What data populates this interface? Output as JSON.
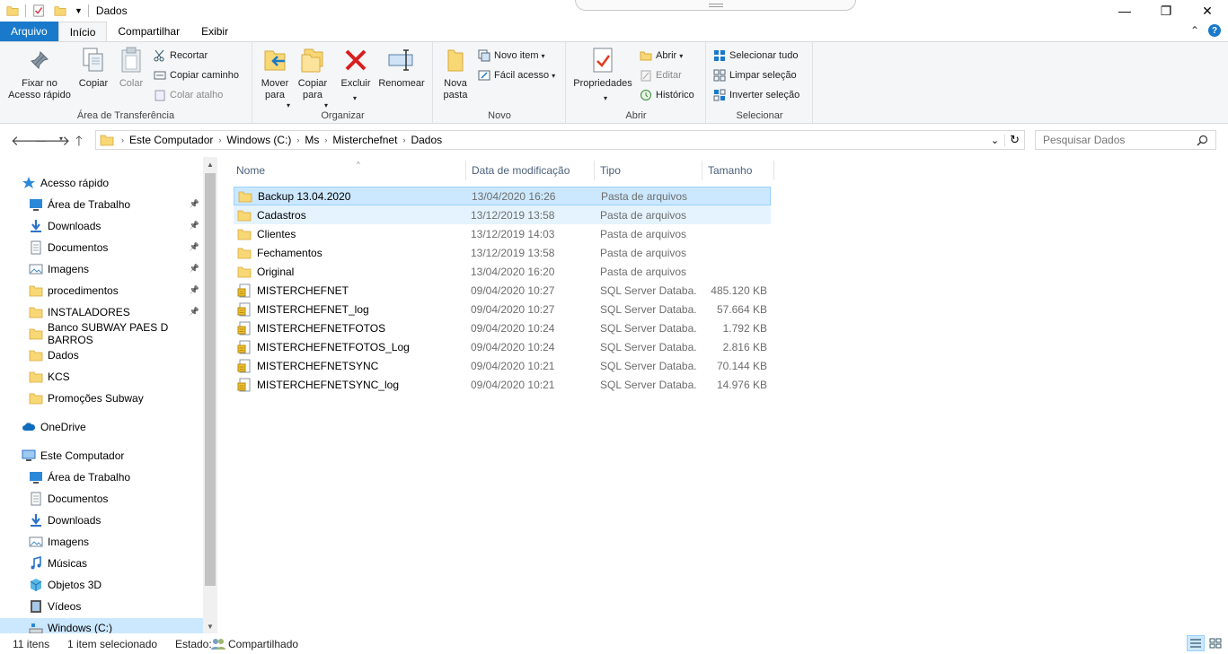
{
  "window": {
    "title": "Dados"
  },
  "ribbon_tabs": [
    "Arquivo",
    "Início",
    "Compartilhar",
    "Exibir"
  ],
  "ribbon": {
    "clipboard": {
      "label": "Área de Transferência",
      "pin": "Fixar no\nAcesso rápido",
      "copy": "Copiar",
      "paste": "Colar",
      "cut": "Recortar",
      "copy_path": "Copiar caminho",
      "paste_shortcut": "Colar atalho"
    },
    "organize": {
      "label": "Organizar",
      "move_to": "Mover\npara",
      "copy_to": "Copiar\npara",
      "delete": "Excluir",
      "rename": "Renomear"
    },
    "new": {
      "label": "Novo",
      "new_folder": "Nova\npasta",
      "new_item": "Novo item",
      "easy_access": "Fácil acesso"
    },
    "open": {
      "label": "Abrir",
      "properties": "Propriedades",
      "open": "Abrir",
      "edit": "Editar",
      "history": "Histórico"
    },
    "select": {
      "label": "Selecionar",
      "select_all": "Selecionar tudo",
      "select_none": "Limpar seleção",
      "invert": "Inverter seleção"
    }
  },
  "address": {
    "crumbs": [
      "Este Computador",
      "Windows (C:)",
      "Ms",
      "Misterchefnet",
      "Dados"
    ]
  },
  "search": {
    "placeholder": "Pesquisar Dados"
  },
  "nav": {
    "quick_access": "Acesso rápido",
    "quick_items": [
      {
        "label": "Área de Trabalho",
        "icon": "desktop-icon",
        "pinned": true
      },
      {
        "label": "Downloads",
        "icon": "download-icon",
        "pinned": true
      },
      {
        "label": "Documentos",
        "icon": "document-icon",
        "pinned": true
      },
      {
        "label": "Imagens",
        "icon": "pictures-icon",
        "pinned": true
      },
      {
        "label": "procedimentos",
        "icon": "folder-icon",
        "pinned": true
      },
      {
        "label": "INSTALADORES",
        "icon": "folder-icon",
        "pinned": true
      },
      {
        "label": "Banco SUBWAY PAES D BARROS",
        "icon": "folder-icon",
        "pinned": false
      },
      {
        "label": "Dados",
        "icon": "folder-icon",
        "pinned": false
      },
      {
        "label": "KCS",
        "icon": "folder-icon",
        "pinned": false
      },
      {
        "label": "Promoções Subway",
        "icon": "folder-icon",
        "pinned": false
      }
    ],
    "onedrive": "OneDrive",
    "this_pc": "Este Computador",
    "pc_items": [
      {
        "label": "Área de Trabalho",
        "icon": "desktop-icon"
      },
      {
        "label": "Documentos",
        "icon": "document-icon"
      },
      {
        "label": "Downloads",
        "icon": "download-icon"
      },
      {
        "label": "Imagens",
        "icon": "pictures-icon"
      },
      {
        "label": "Músicas",
        "icon": "music-icon"
      },
      {
        "label": "Objetos 3D",
        "icon": "3d-objects-icon"
      },
      {
        "label": "Vídeos",
        "icon": "video-icon"
      },
      {
        "label": "Windows (C:)",
        "icon": "drive-icon"
      }
    ]
  },
  "columns": [
    "Nome",
    "Data de modificação",
    "Tipo",
    "Tamanho"
  ],
  "files": [
    {
      "name": "Backup 13.04.2020",
      "date": "13/04/2020 16:26",
      "type": "Pasta de arquivos",
      "size": "",
      "kind": "folder"
    },
    {
      "name": "Cadastros",
      "date": "13/12/2019 13:58",
      "type": "Pasta de arquivos",
      "size": "",
      "kind": "folder"
    },
    {
      "name": "Clientes",
      "date": "13/12/2019 14:03",
      "type": "Pasta de arquivos",
      "size": "",
      "kind": "folder"
    },
    {
      "name": "Fechamentos",
      "date": "13/12/2019 13:58",
      "type": "Pasta de arquivos",
      "size": "",
      "kind": "folder"
    },
    {
      "name": "Original",
      "date": "13/04/2020 16:20",
      "type": "Pasta de arquivos",
      "size": "",
      "kind": "folder"
    },
    {
      "name": "MISTERCHEFNET",
      "date": "09/04/2020 10:27",
      "type": "SQL Server Databa...",
      "size": "485.120 KB",
      "kind": "db"
    },
    {
      "name": "MISTERCHEFNET_log",
      "date": "09/04/2020 10:27",
      "type": "SQL Server Databa...",
      "size": "57.664 KB",
      "kind": "db"
    },
    {
      "name": "MISTERCHEFNETFOTOS",
      "date": "09/04/2020 10:24",
      "type": "SQL Server Databa...",
      "size": "1.792 KB",
      "kind": "db"
    },
    {
      "name": "MISTERCHEFNETFOTOS_Log",
      "date": "09/04/2020 10:24",
      "type": "SQL Server Databa...",
      "size": "2.816 KB",
      "kind": "db"
    },
    {
      "name": "MISTERCHEFNETSYNC",
      "date": "09/04/2020 10:21",
      "type": "SQL Server Databa...",
      "size": "70.144 KB",
      "kind": "db"
    },
    {
      "name": "MISTERCHEFNETSYNC_log",
      "date": "09/04/2020 10:21",
      "type": "SQL Server Databa...",
      "size": "14.976 KB",
      "kind": "db"
    }
  ],
  "status": {
    "count": "11 itens",
    "selected": "1 item selecionado",
    "state_label": "Estado:",
    "state_value": "Compartilhado"
  },
  "colors": {
    "accent": "#1979ca",
    "selection": "#cce8ff",
    "folder": "#f8d775",
    "header_text": "#4c607a"
  }
}
